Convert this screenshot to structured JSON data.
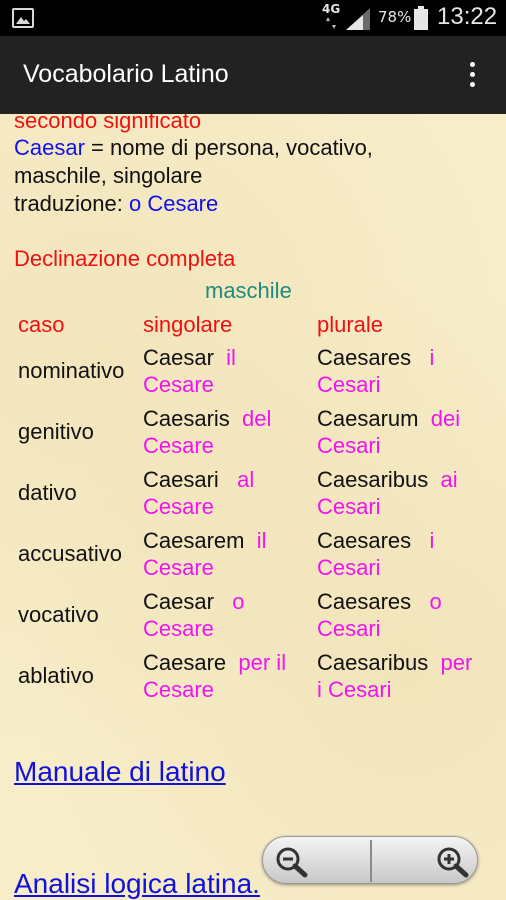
{
  "status": {
    "network": "4G",
    "battery": "78%",
    "time": "13:22"
  },
  "app": {
    "title": "Vocabolario Latino"
  },
  "entry": {
    "heading": "secondo significato",
    "word": "Caesar",
    "definition_line1": " = nome di persona, vocativo,",
    "definition_line2": "maschile, singolare",
    "translation_label": "traduzione: ",
    "translation": "o Cesare"
  },
  "declension": {
    "title": "Declinazione completa",
    "gender": "maschile",
    "headers": {
      "case": "caso",
      "singular": "singolare",
      "plural": "plurale"
    },
    "rows": [
      {
        "case": "nominativo",
        "sg": "Caesar",
        "sg_art": "il",
        "sg_tr": "Cesare",
        "pl": "Caesares",
        "pl_art": "i",
        "pl_tr": "Cesari"
      },
      {
        "case": "genitivo",
        "sg": "Caesaris",
        "sg_art": "del",
        "sg_tr": "Cesare",
        "pl": "Caesarum",
        "pl_art": "dei",
        "pl_tr": "Cesari"
      },
      {
        "case": "dativo",
        "sg": "Caesari",
        "sg_art": "al",
        "sg_tr": "Cesare",
        "pl": "Caesaribus",
        "pl_art": "ai",
        "pl_tr": "Cesari"
      },
      {
        "case": "accusativo",
        "sg": "Caesarem",
        "sg_art": "il",
        "sg_tr": "Cesare",
        "pl": "Caesares",
        "pl_art": "i",
        "pl_tr": "Cesari"
      },
      {
        "case": "vocativo",
        "sg": "Caesar",
        "sg_art": "o",
        "sg_tr": "Cesare",
        "pl": "Caesares",
        "pl_art": "o",
        "pl_tr": "Cesari"
      },
      {
        "case": "ablativo",
        "sg": "Caesare",
        "sg_art": "per il",
        "sg_tr": "Cesare",
        "pl": "Caesaribus",
        "pl_art": "per",
        "pl_tr": "i Cesari"
      }
    ]
  },
  "links": {
    "manual": "Manuale di latino",
    "analysis": "Analisi logica latina."
  },
  "icons": {
    "notification": "image-icon",
    "signal": "signal-icon",
    "battery": "battery-icon",
    "overflow": "more-vert-icon",
    "zoom_out": "zoom-out-icon",
    "zoom_in": "zoom-in-icon"
  },
  "colors": {
    "label_red": "#ee1111",
    "word_blue": "#1111ee",
    "translation_magenta": "#f014f0",
    "gender_teal": "#1e8a80",
    "parchment": "#f7edc9"
  }
}
